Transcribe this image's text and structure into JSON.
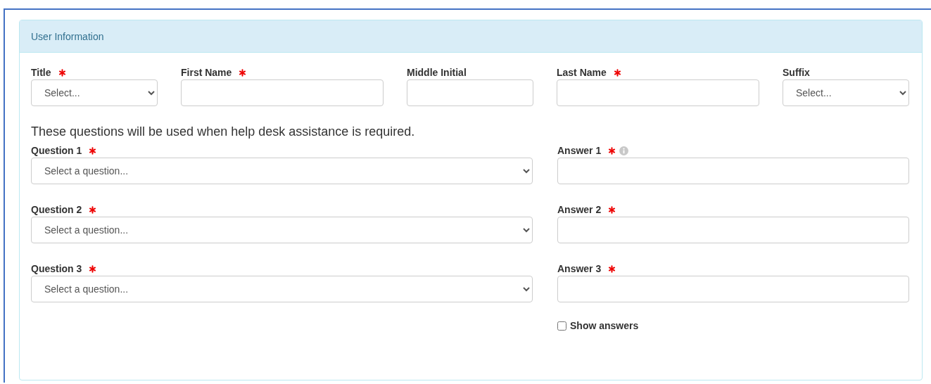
{
  "panel": {
    "title": "User Information"
  },
  "name_fields": [
    {
      "label": "Title",
      "required": true,
      "kind": "select",
      "placeholder": "Select..."
    },
    {
      "label": "First Name",
      "required": true,
      "kind": "text"
    },
    {
      "label": "Middle Initial",
      "required": false,
      "kind": "text"
    },
    {
      "label": "Last Name",
      "required": true,
      "kind": "text"
    },
    {
      "label": "Suffix",
      "required": false,
      "kind": "select",
      "placeholder": "Select..."
    }
  ],
  "help_text": "These questions will be used when help desk assistance is required.",
  "security_rows": [
    {
      "question": {
        "label": "Question 1",
        "required": true,
        "placeholder": "Select a question..."
      },
      "answer": {
        "label": "Answer 1",
        "required": true,
        "info": true
      }
    },
    {
      "question": {
        "label": "Question 2",
        "required": true,
        "placeholder": "Select a question..."
      },
      "answer": {
        "label": "Answer 2",
        "required": true,
        "info": false
      }
    },
    {
      "question": {
        "label": "Question 3",
        "required": true,
        "placeholder": "Select a question..."
      },
      "answer": {
        "label": "Answer 3",
        "required": true,
        "info": false
      }
    }
  ],
  "show_answers": {
    "label": "Show answers",
    "checked": false
  }
}
